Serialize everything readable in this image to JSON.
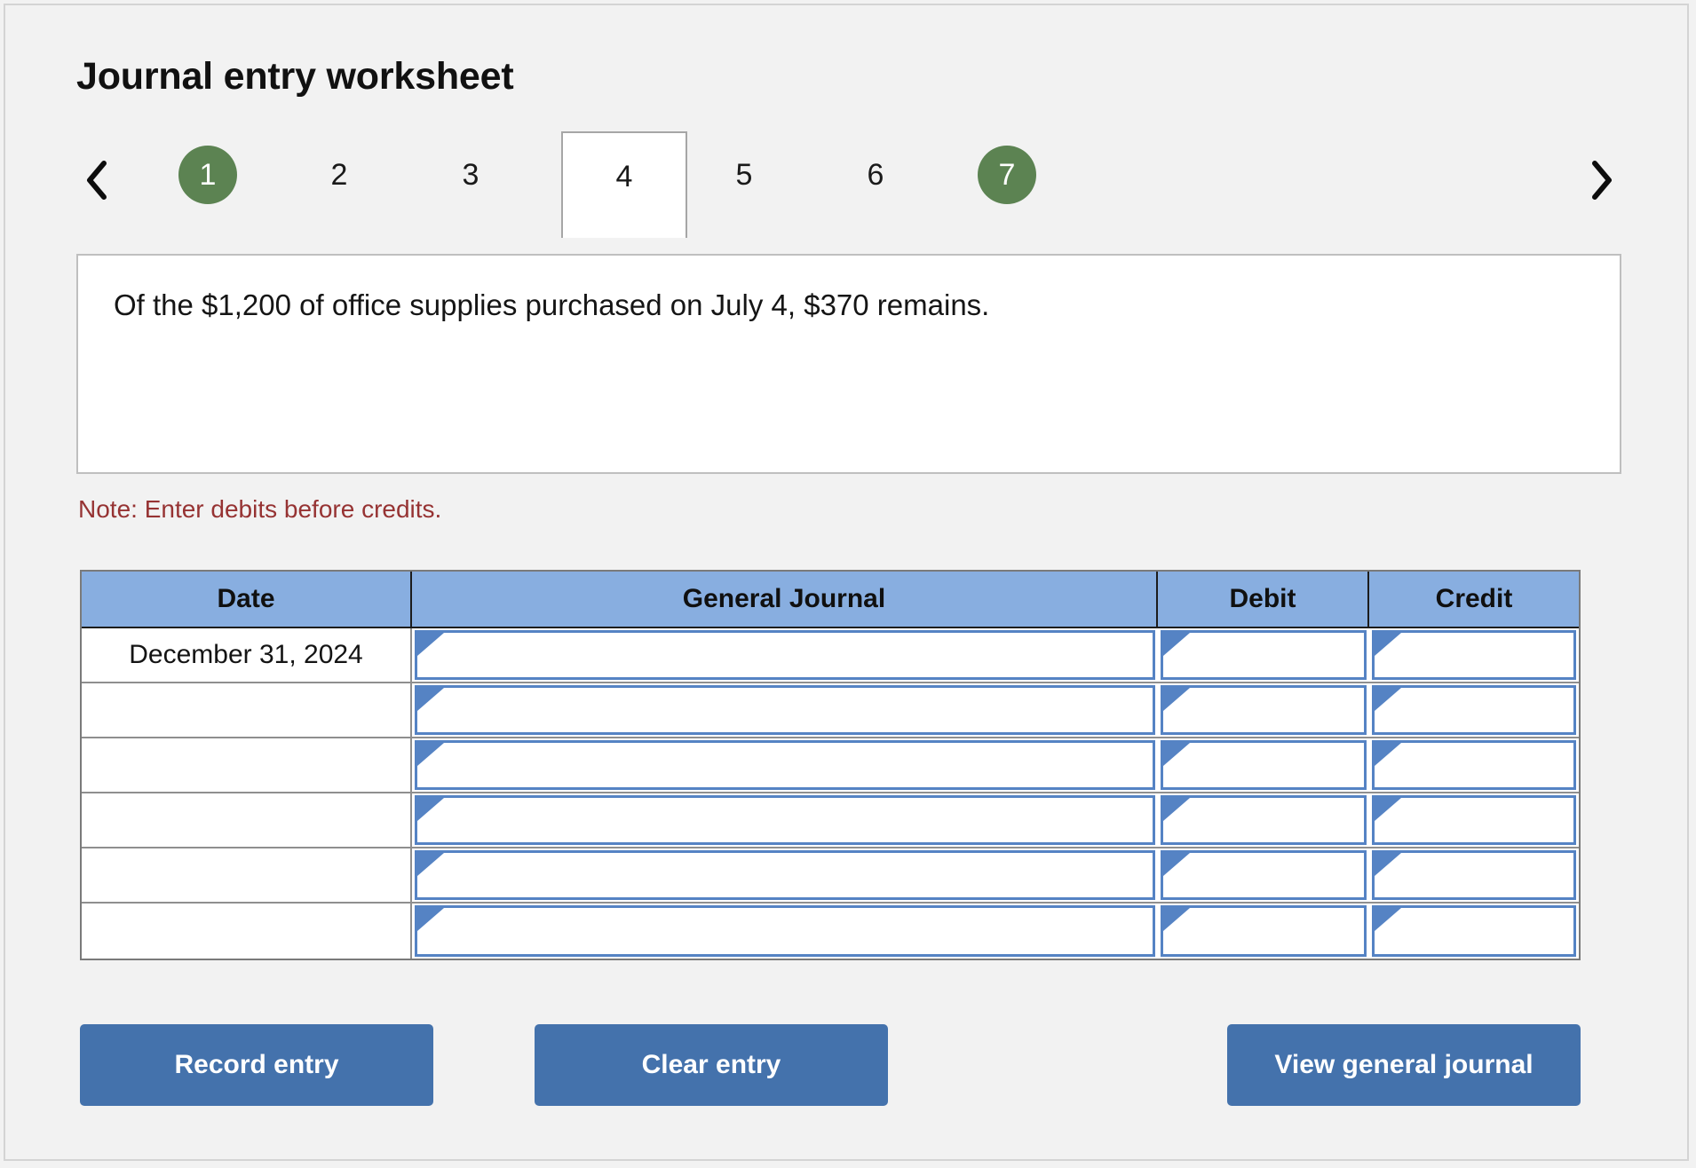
{
  "page": {
    "title": "Journal entry worksheet",
    "background_color": "#f2f2f2"
  },
  "tabs": {
    "prev_label": "‹",
    "next_label": "›",
    "items": [
      {
        "label": "1",
        "state": "completed"
      },
      {
        "label": "2",
        "state": "default"
      },
      {
        "label": "3",
        "state": "default"
      },
      {
        "label": "4",
        "state": "active"
      },
      {
        "label": "5",
        "state": "default"
      },
      {
        "label": "6",
        "state": "default"
      },
      {
        "label": "7",
        "state": "completed"
      }
    ],
    "completed_color": "#5c8352",
    "active_color": "#ffffff"
  },
  "content": {
    "text": "Of the $1,200 of office supplies purchased on July 4, $370 remains."
  },
  "note": {
    "text": "Note: Enter debits before credits.",
    "color": "#963333"
  },
  "table": {
    "header_color": "#88aee0",
    "columns": [
      "Date",
      "General Journal",
      "Debit",
      "Credit"
    ],
    "rows": [
      {
        "date": "December 31, 2024",
        "general_journal": "",
        "debit": "",
        "credit": ""
      },
      {
        "date": "",
        "general_journal": "",
        "debit": "",
        "credit": ""
      },
      {
        "date": "",
        "general_journal": "",
        "debit": "",
        "credit": ""
      },
      {
        "date": "",
        "general_journal": "",
        "debit": "",
        "credit": ""
      },
      {
        "date": "",
        "general_journal": "",
        "debit": "",
        "credit": ""
      },
      {
        "date": "",
        "general_journal": "",
        "debit": "",
        "credit": ""
      }
    ]
  },
  "buttons": {
    "record_entry": "Record entry",
    "clear_entry": "Clear entry",
    "view_general_journal": "View general journal",
    "color": "#4472ac"
  }
}
